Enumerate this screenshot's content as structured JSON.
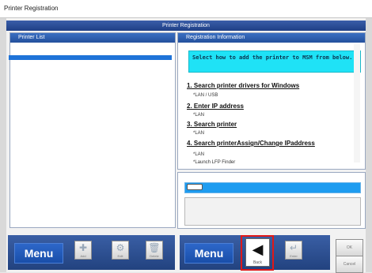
{
  "window": {
    "title": "Printer Registration",
    "header_title": "Printer Registration"
  },
  "left_panel": {
    "title": "Printer List"
  },
  "right_panel": {
    "title": "Registration Information",
    "instruction": "Select how to add the printer to MSM from below.",
    "options": [
      {
        "label": "1. Search printer drivers for Windows",
        "sub": "*LAN / USB"
      },
      {
        "label": "2. Enter IP address",
        "sub": "*LAN"
      },
      {
        "label": "3. Search printer",
        "sub": "*LAN"
      },
      {
        "label": "4. Search printerAssign/Change IPaddress",
        "sub1": "*LAN",
        "sub2": "*Launch LFP Finder"
      }
    ]
  },
  "toolbar_left": {
    "menu": "Menu",
    "add": "Add",
    "edit": "Edit",
    "delete": "Delete"
  },
  "toolbar_right": {
    "menu": "Menu",
    "back": "Back",
    "enter": "Enter",
    "ok": "OK",
    "cancel": "Cancel"
  },
  "colors": {
    "instruction_bg": "#1fe2f6",
    "selection": "#1e73d8",
    "highlight": "#e01818",
    "toolbar": "#22427f"
  }
}
